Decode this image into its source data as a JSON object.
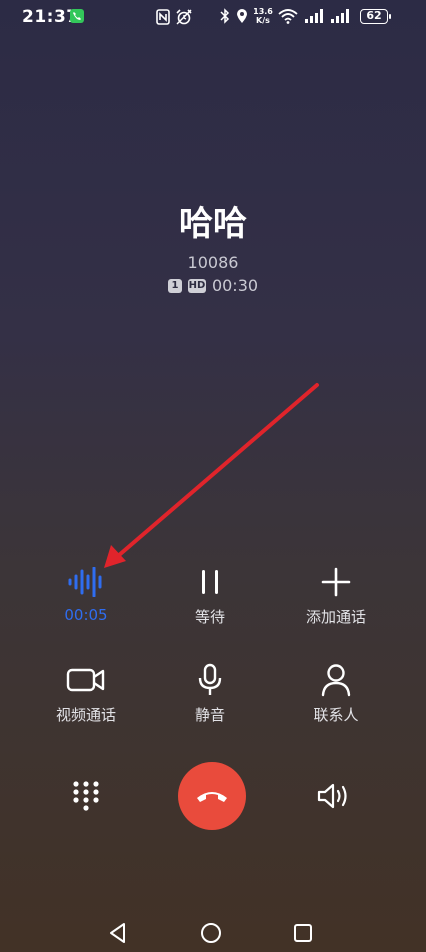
{
  "status_bar": {
    "time": "21:37",
    "speed_top": "13.6",
    "speed_bottom": "K/s",
    "battery": "62",
    "icons": [
      "call-active-icon",
      "nfc-icon",
      "alarm-icon",
      "bluetooth-icon",
      "location-icon",
      "wifi-icon",
      "signal-icon",
      "signal-icon",
      "battery-icon"
    ]
  },
  "caller": {
    "name": "哈哈",
    "number": "10086",
    "sim": "1",
    "hd": "HD",
    "duration": "00:30"
  },
  "controls": {
    "record": {
      "label": "00:05",
      "icon": "voice-wave-icon",
      "color": "#2f6df0"
    },
    "hold": {
      "label": "等待",
      "icon": "pause-icon"
    },
    "add_call": {
      "label": "添加通话",
      "icon": "plus-icon"
    },
    "video_call": {
      "label": "视频通话",
      "icon": "video-camera-icon"
    },
    "mute": {
      "label": "静音",
      "icon": "microphone-icon"
    },
    "contacts": {
      "label": "联系人",
      "icon": "person-icon"
    }
  },
  "bottom": {
    "dialpad": "dialpad-icon",
    "end_call": "end-call-icon",
    "end_call_color": "#e94b3c",
    "speaker": "speaker-icon"
  },
  "annotation": {
    "color": "#e0242b"
  }
}
